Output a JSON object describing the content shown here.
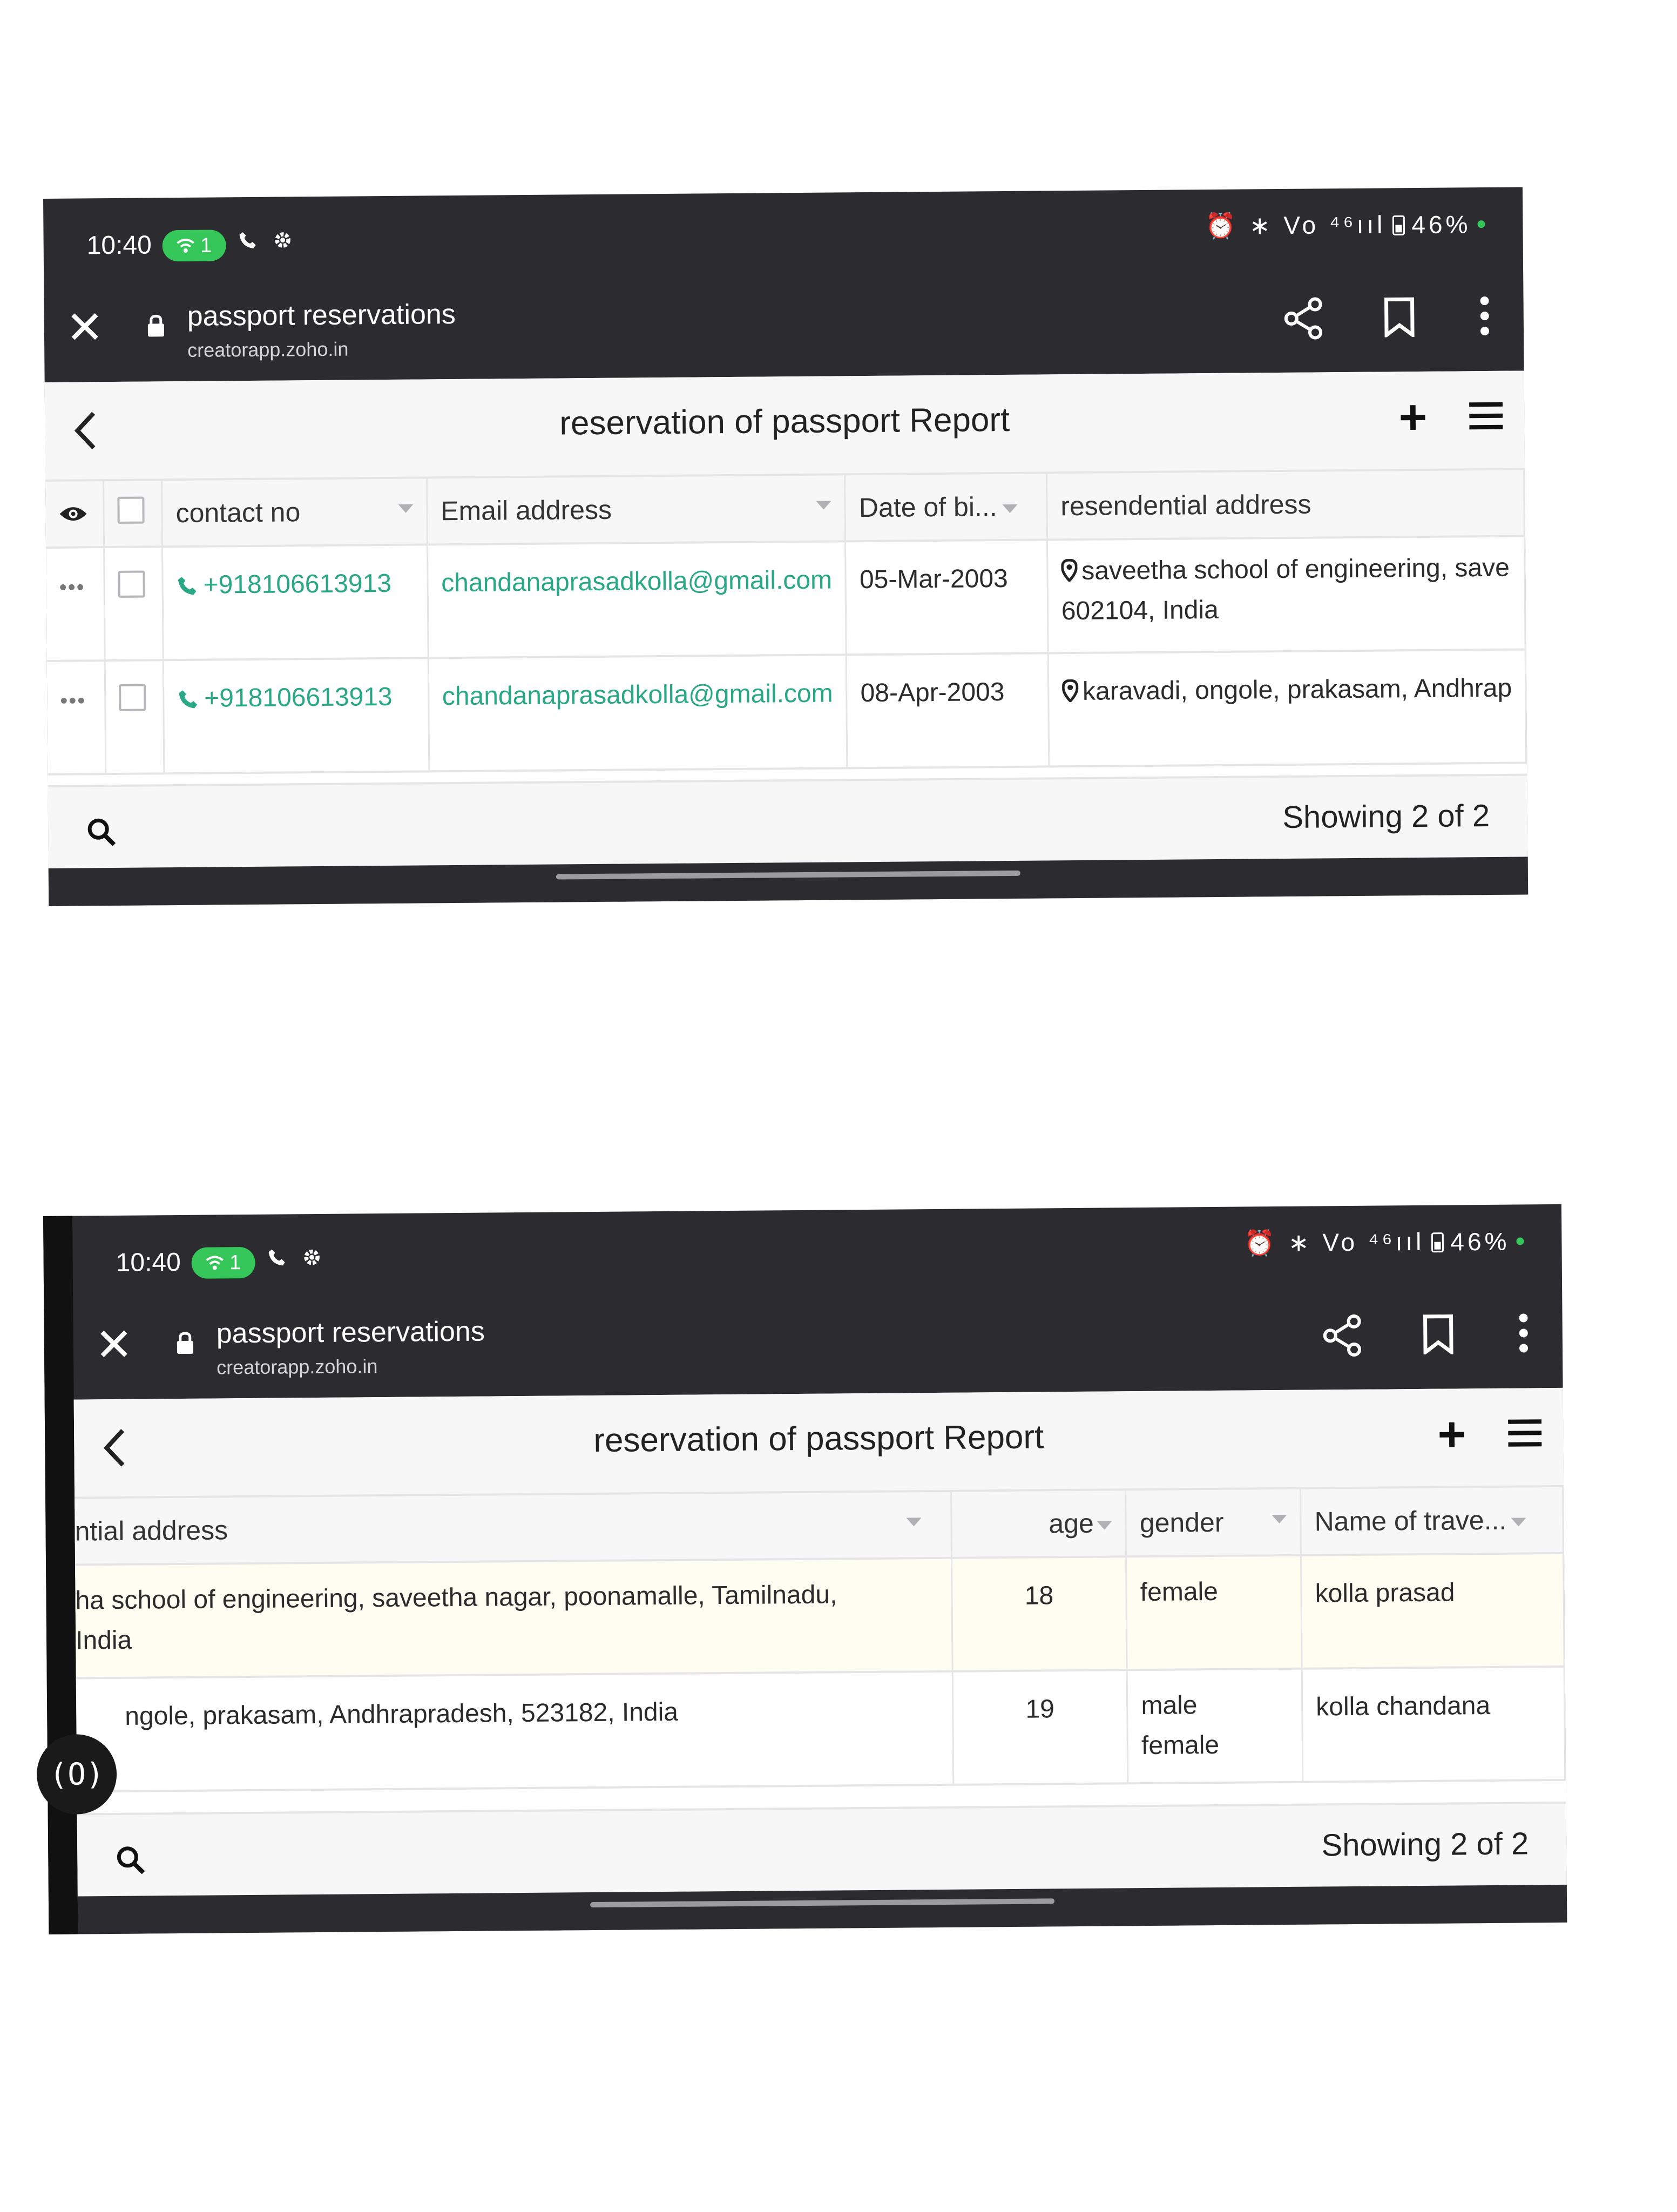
{
  "status_bar": {
    "time": "10:40",
    "hotspot_count": "1",
    "right_icons": "⏰ ∗ Vo ⁴⁶ııl",
    "battery": "46%"
  },
  "browser": {
    "page_title": "passport reservations",
    "url": "creatorapp.zoho.in"
  },
  "report": {
    "title": "reservation of passport Report",
    "showing": "Showing 2 of 2"
  },
  "view1": {
    "columns": [
      "contact no",
      "Email address",
      "Date of bi...",
      "resendential address"
    ],
    "rows": [
      {
        "contact": "+918106613913",
        "email": "chandanaprasadkolla@gmail.com",
        "dob": "05-Mar-2003",
        "address_line1": "saveetha school of engineering, save",
        "address_line2": "602104, India"
      },
      {
        "contact": "+918106613913",
        "email": "chandanaprasadkolla@gmail.com",
        "dob": "08-Apr-2003",
        "address_line1": "karavadi, ongole, prakasam, Andhrap",
        "address_line2": ""
      }
    ]
  },
  "view2": {
    "columns": [
      "ntial address",
      "age",
      "gender",
      "Name of trave..."
    ],
    "rows": [
      {
        "address_line1": "ha school of engineering, saveetha nagar, poonamalle, Tamilnadu,",
        "address_line2": " India",
        "age": "18",
        "gender_line1": "female",
        "gender_line2": "",
        "name": "kolla prasad"
      },
      {
        "address_line1": "ngole, prakasam, Andhrapradesh, 523182, India",
        "address_line2": "",
        "age": "19",
        "gender_line1": "male",
        "gender_line2": "female",
        "name": "kolla chandana"
      }
    ]
  },
  "floating_button": "(O)",
  "colors": {
    "accent_green": "#2aa886",
    "hotspot_green": "#35c759",
    "chrome_dark": "#2b2b30"
  }
}
